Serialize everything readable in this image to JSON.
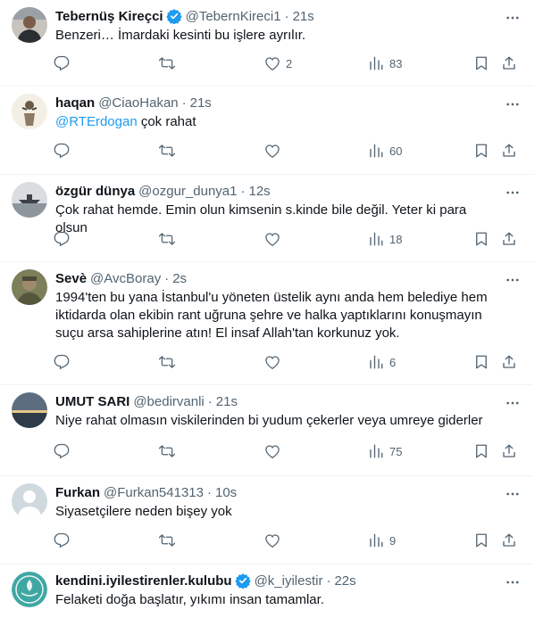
{
  "colors": {
    "accent": "#1d9bf0",
    "muted": "#536471",
    "text": "#0f1419",
    "divider": "#eff3f4"
  },
  "icons": {
    "reply": "reply-icon",
    "retweet": "retweet-icon",
    "like": "heart-icon",
    "views": "views-chart-icon",
    "bookmark": "bookmark-icon",
    "share": "share-icon",
    "more": "more-dots-icon",
    "verified": "verified-badge-icon"
  },
  "tweets": [
    {
      "name": "Tebernüş Kireçci",
      "handle": "@TebernKireci1",
      "sep": "·",
      "time": "21s",
      "verified": true,
      "text": "Benzeri… İmardaki kesinti bu işlere ayrılır.",
      "mention": "",
      "likes": "2",
      "views": "83"
    },
    {
      "name": "haqan",
      "handle": "@CiaoHakan",
      "sep": "·",
      "time": "21s",
      "verified": false,
      "mention": "@RTErdogan",
      "text": " çok rahat",
      "likes": "",
      "views": "60"
    },
    {
      "name": "özgür dünya",
      "handle": "@ozgur_dunya1",
      "sep": "·",
      "time": "12s",
      "verified": false,
      "text": "Çok rahat hemde. Emin olun kimsenin s.kinde bile değil. Yeter ki para olsun",
      "mention": "",
      "likes": "",
      "views": "18"
    },
    {
      "name": "Sevè",
      "handle": "@AvcBoray",
      "sep": "·",
      "time": "2s",
      "verified": false,
      "text": "1994'ten bu yana İstanbul'u yöneten üstelik aynı anda hem belediye hem iktidarda olan ekibin rant uğruna şehre ve halka yaptıklarını konuşmayın suçu arsa sahiplerine atın! El insaf Allah'tan korkunuz yok.",
      "mention": "",
      "likes": "",
      "views": "6"
    },
    {
      "name": "UMUT SARI",
      "handle": "@bedirvanli",
      "sep": "·",
      "time": "21s",
      "verified": false,
      "text": "Niye rahat olmasın viskilerinden bi yudum çekerler veya umreye giderler",
      "mention": "",
      "likes": "",
      "views": "75"
    },
    {
      "name": "Furkan",
      "handle": "@Furkan541313",
      "sep": "·",
      "time": "10s",
      "verified": false,
      "text": "Siyasetçilere neden bişey yok",
      "mention": "",
      "likes": "",
      "views": "9"
    },
    {
      "name": "kendini.iyilestirenler.kulubu",
      "handle": "@k_iyilestir",
      "sep": "·",
      "time": "22s",
      "verified": true,
      "text": "Felaketi doğa başlatır, yıkımı insan tamamlar.",
      "mention": "",
      "likes": "",
      "views": ""
    }
  ]
}
